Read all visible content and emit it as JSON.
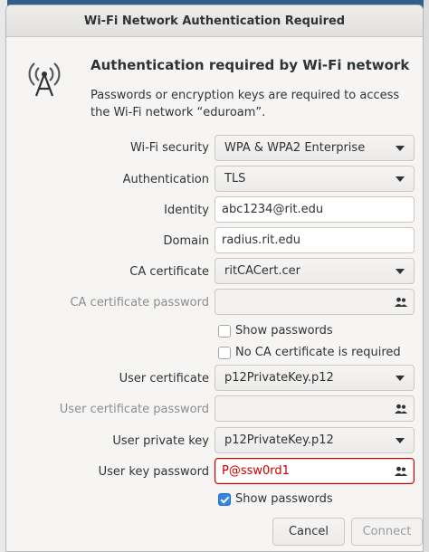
{
  "window": {
    "title": "Wi-Fi Network Authentication Required"
  },
  "header": {
    "heading": "Authentication required by Wi-Fi network",
    "description": "Passwords or encryption keys are required to access the Wi-Fi network “eduroam”.",
    "icon": "wifi-antenna-icon"
  },
  "form": {
    "wifi_security": {
      "label": "Wi-Fi security",
      "value": "WPA & WPA2 Enterprise"
    },
    "authentication": {
      "label": "Authentication",
      "value": "TLS"
    },
    "identity": {
      "label": "Identity",
      "value": "abc1234@rit.edu"
    },
    "domain": {
      "label": "Domain",
      "value": "radius.rit.edu"
    },
    "ca_certificate": {
      "label": "CA certificate",
      "value": "ritCACert.cer"
    },
    "ca_cert_password": {
      "label": "CA certificate password",
      "value": ""
    },
    "show_passwords_1": {
      "label": "Show passwords",
      "checked": false
    },
    "no_ca_required": {
      "label": "No CA certificate is required",
      "checked": false
    },
    "user_certificate": {
      "label": "User certificate",
      "value": "p12PrivateKey.p12"
    },
    "user_cert_password": {
      "label": "User certificate password",
      "value": ""
    },
    "user_private_key": {
      "label": "User private key",
      "value": "p12PrivateKey.p12"
    },
    "user_key_password": {
      "label": "User key password",
      "value": "P@ssw0rd1"
    },
    "show_passwords_2": {
      "label": "Show passwords",
      "checked": true
    }
  },
  "buttons": {
    "cancel": "Cancel",
    "connect": "Connect"
  },
  "colors": {
    "accent": "#3584e4",
    "error": "#cc0000",
    "background": "#f6f5f4"
  }
}
